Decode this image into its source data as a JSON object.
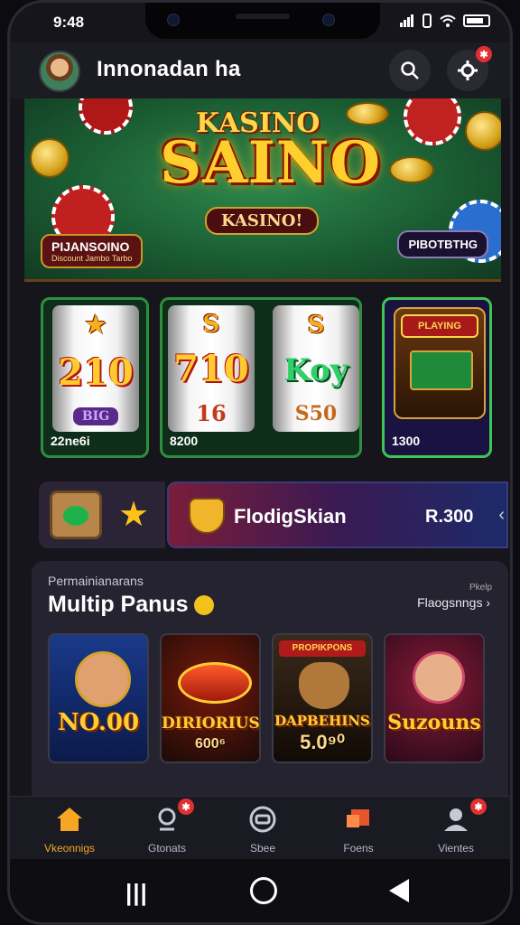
{
  "status_bar": {
    "time": "9:48"
  },
  "header": {
    "title": "Innonadan ha",
    "settings_badge": "✱"
  },
  "hero": {
    "logo_top": "KASINO",
    "logo_main": "SAINO",
    "logo_sub": "KASINO!",
    "badge_left_title": "PIJANSOINO",
    "badge_left_sub": "Discount Jambo Tarbo",
    "badge_right": "PIBOTBTHG"
  },
  "slots": [
    {
      "symbols": [
        "★",
        "210",
        "BIG"
      ],
      "label": "22ne6i"
    },
    {
      "symbols": [
        "S",
        "710",
        "16"
      ],
      "label": "8200"
    },
    {
      "symbols": [
        "S",
        "Koy",
        "S50"
      ],
      "label": ""
    },
    {
      "machine_sign": "PLAYING",
      "label": "1300"
    }
  ],
  "promo": {
    "title": "FlodigSkian",
    "amount": "R.300",
    "arrow": "‹"
  },
  "section": {
    "overline": "Permainianarans",
    "title": "Multip Panus",
    "link_top": "Pkelp",
    "link": "Flaogsnngs ›",
    "games": [
      {
        "title": "NO.00",
        "sub": ""
      },
      {
        "title": "DIRIORIUS",
        "sub": "600⁶"
      },
      {
        "title": "DAPBEHINS",
        "sub": "5.0⁹⁰",
        "banner": "PROPIKPONS"
      },
      {
        "title": "Suzouns",
        "sub": ""
      }
    ]
  },
  "tabs": [
    {
      "label": "Vkeonnigs",
      "active": true
    },
    {
      "label": "Gtonats",
      "badge": "✱"
    },
    {
      "label": "Sbee"
    },
    {
      "label": "Foens"
    },
    {
      "label": "Vientes",
      "badge": "✱"
    }
  ],
  "colors": {
    "accent": "#f5a623",
    "badge": "#e23030",
    "felt": "#1b5e33",
    "tile_border": "#2f8e3e"
  }
}
